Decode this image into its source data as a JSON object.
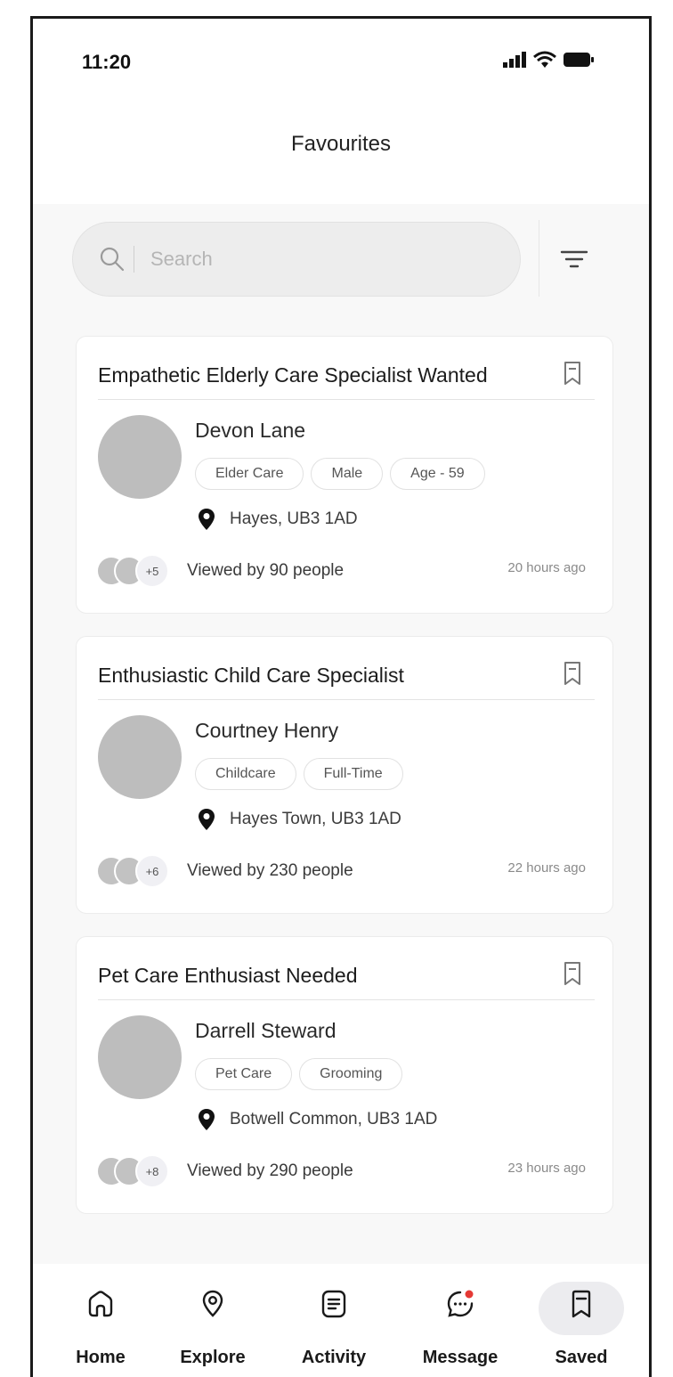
{
  "status_bar": {
    "time": "11:20"
  },
  "header": {
    "title": "Favourites"
  },
  "search": {
    "placeholder": "Search"
  },
  "cards": [
    {
      "title": "Empathetic Elderly Care Specialist Wanted",
      "name": "Devon Lane",
      "tags": [
        "Elder Care",
        "Male",
        "Age - 59"
      ],
      "location": "Hayes, UB3 1AD",
      "extra_viewers": "+5",
      "viewed": "Viewed by 90 people",
      "ago": "20 hours ago"
    },
    {
      "title": "Enthusiastic Child Care Specialist",
      "name": "Courtney Henry",
      "tags": [
        "Childcare",
        "Full-Time"
      ],
      "location": "Hayes Town, UB3 1AD",
      "extra_viewers": "+6",
      "viewed": "Viewed by 230 people",
      "ago": "22 hours ago"
    },
    {
      "title": "Pet Care Enthusiast Needed",
      "name": "Darrell Steward",
      "tags": [
        "Pet Care",
        "Grooming"
      ],
      "location": "Botwell Common, UB3 1AD",
      "extra_viewers": "+8",
      "viewed": "Viewed by 290 people",
      "ago": "23 hours ago"
    }
  ],
  "nav": {
    "items": [
      {
        "label": "Home",
        "icon": "home-icon"
      },
      {
        "label": "Explore",
        "icon": "location-icon"
      },
      {
        "label": "Activity",
        "icon": "activity-icon"
      },
      {
        "label": "Message",
        "icon": "message-icon"
      },
      {
        "label": "Saved",
        "icon": "bookmark-icon"
      }
    ],
    "active": "Saved"
  },
  "colors": {
    "notification_dot": "#e53935",
    "avatar_placeholder": "#bdbdbd"
  }
}
